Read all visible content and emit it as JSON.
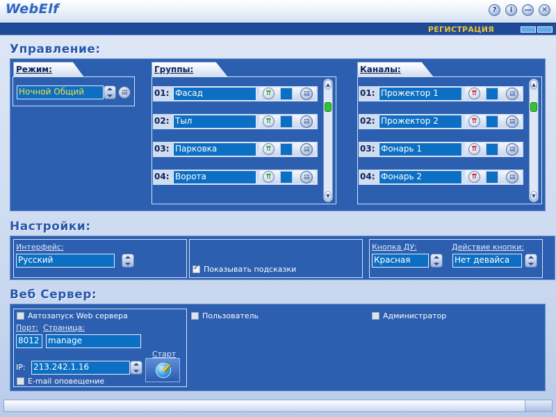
{
  "app": {
    "title": "WebElf"
  },
  "titlebar": {
    "buttons": [
      {
        "name": "help-icon",
        "glyph": "?"
      },
      {
        "name": "info-icon",
        "glyph": "i"
      },
      {
        "name": "minimize-icon",
        "glyph": "—"
      },
      {
        "name": "close-icon",
        "glyph": "✕"
      }
    ]
  },
  "band": {
    "register_label": "РЕГИСТРАЦИЯ"
  },
  "control": {
    "title": "Управление:",
    "mode": {
      "tab_label": "Режим:",
      "value": "Ночной Общий"
    },
    "groups": {
      "tab_label": "Группы:",
      "items": [
        {
          "num": "01:",
          "name": "Фасад"
        },
        {
          "num": "02:",
          "name": "Тыл"
        },
        {
          "num": "03:",
          "name": "Парковка"
        },
        {
          "num": "04:",
          "name": "Ворота"
        }
      ]
    },
    "channels": {
      "tab_label": "Каналы:",
      "items": [
        {
          "num": "01:",
          "name": "Прожектор 1"
        },
        {
          "num": "02:",
          "name": "Прожектор 2"
        },
        {
          "num": "03:",
          "name": "Фонарь 1"
        },
        {
          "num": "04:",
          "name": "Фонарь 2"
        }
      ]
    }
  },
  "settings": {
    "title": "Настройки:",
    "interface_label": "Интерфейс:",
    "interface_value": "Русский",
    "show_hints_label": "Показывать подсказки",
    "show_hints_checked": true,
    "remote_button_label": "Кнопка ДУ:",
    "remote_button_value": "Красная",
    "button_action_label": "Действие кнопки:",
    "button_action_value": "Нет девайса"
  },
  "webserver": {
    "title": "Веб Сервер:",
    "autostart_label": "Автозапуск Web сервера",
    "port_label": "Порт:",
    "page_label": "Страница:",
    "port_value": "8012",
    "page_value": "manage",
    "ip_label": "IP:",
    "ip_value": "213.242.1.16",
    "email_label": "E-mail оповещение",
    "start_label": "Старт",
    "user_label": "Пользователь",
    "admin_label": "Администратор"
  },
  "colors": {
    "accent": "#2c5fb0",
    "field": "#0d6fc3",
    "link_yellow": "#f2c42a"
  }
}
